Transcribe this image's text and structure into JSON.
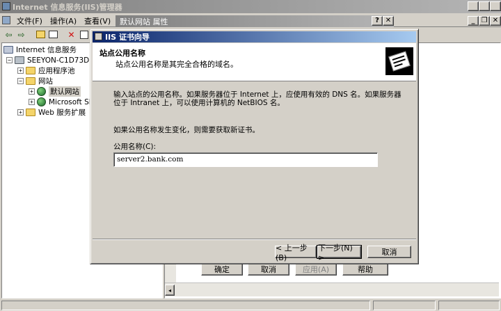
{
  "window": {
    "title": "Internet 信息服务(IIS)管理器"
  },
  "menu": {
    "items": [
      "文件(F)",
      "操作(A)",
      "查看(V)"
    ]
  },
  "properties_dialog": {
    "title": "默认网站 属性",
    "buttons": {
      "ok": "确定",
      "cancel": "取消",
      "apply": "应用(A)",
      "help": "帮助"
    }
  },
  "tree": {
    "root": "Internet 信息服务",
    "server": "SEEYON-C1D73D39 (本",
    "app_pool": "应用程序池",
    "websites": "网站",
    "default_site": "默认网站",
    "ms_site": "Microsoft SI",
    "web_ext": "Web 服务扩展"
  },
  "wizard": {
    "title": "IIS 证书向导",
    "header_title": "站点公用名称",
    "header_subtitle": "站点公用名称是其完全合格的域名。",
    "body_line1": "输入站点的公用名称。如果服务器位于 Internet 上，应使用有效的 DNS 名。如果服务器",
    "body_line2": "位于 Intranet 上，可以使用计算机的 NetBIOS 名。",
    "body_line3": "如果公用名称发生变化，则需要获取新证书。",
    "field_label": "公用名称(C):",
    "field_value": "server2.bank.com",
    "back_label": "< 上一步(B)",
    "next_label": "下一步(N) >",
    "cancel_label": "取消"
  }
}
